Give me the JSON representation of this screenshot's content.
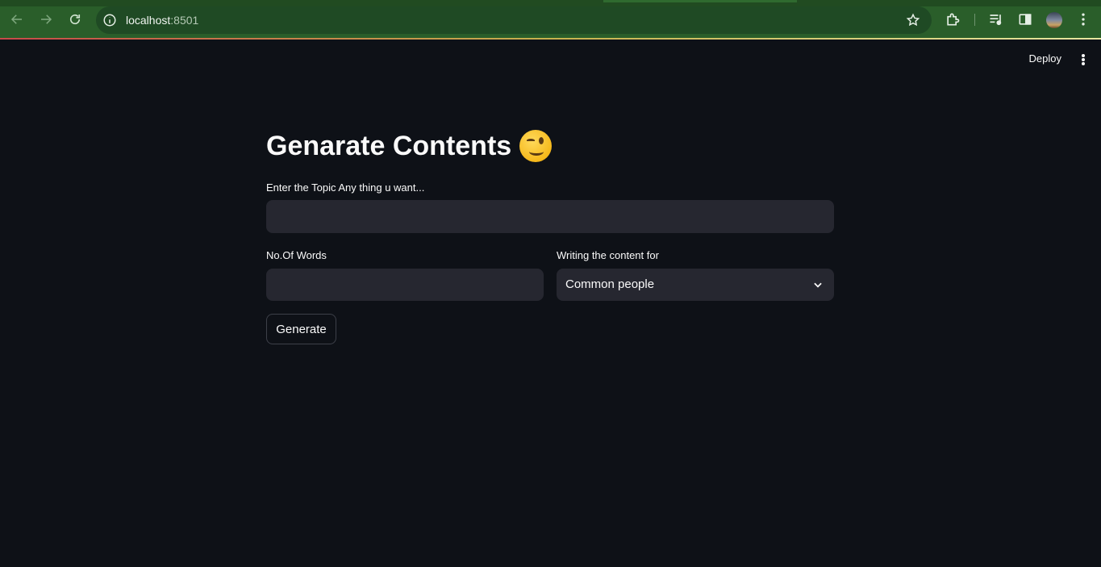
{
  "browser": {
    "url_host": "localhost",
    "url_port": ":8501"
  },
  "header": {
    "deploy_label": "Deploy"
  },
  "main": {
    "title": "Genarate Contents",
    "topic_label": "Enter the Topic Any thing u want...",
    "topic_value": "",
    "words_label": "No.Of Words",
    "words_value": "",
    "audience_label": "Writing the content for",
    "audience_value": "Common people",
    "generate_label": "Generate"
  },
  "colors": {
    "background": "#0e1117",
    "input_bg": "#262730",
    "chrome": "#2a5e2a"
  }
}
